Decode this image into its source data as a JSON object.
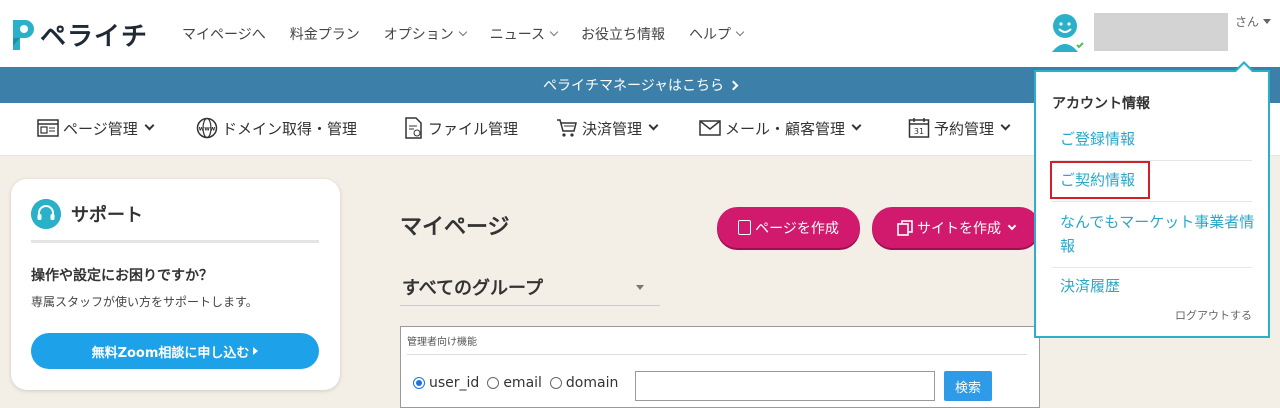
{
  "header": {
    "logo_text": "ペライチ",
    "nav": [
      {
        "label": "マイページへ",
        "has_chevron": false
      },
      {
        "label": "料金プラン",
        "has_chevron": false
      },
      {
        "label": "オプション",
        "has_chevron": true
      },
      {
        "label": "ニュース",
        "has_chevron": true
      },
      {
        "label": "お役立ち情報",
        "has_chevron": false
      },
      {
        "label": "ヘルプ",
        "has_chevron": true
      }
    ],
    "user_suffix": "さん"
  },
  "banner": {
    "text": "ペライチマネージャはこちら"
  },
  "subnav": [
    {
      "label": "ページ管理",
      "icon": "page-icon"
    },
    {
      "label": "ドメイン取得・管理",
      "icon": "www-icon"
    },
    {
      "label": "ファイル管理",
      "icon": "file-icon"
    },
    {
      "label": "決済管理",
      "icon": "cart-icon"
    },
    {
      "label": "メール・顧客管理",
      "icon": "mail-icon"
    },
    {
      "label": "予約管理",
      "icon": "calendar-icon",
      "calendar_day": "31"
    }
  ],
  "support": {
    "title": "サポート",
    "question": "操作や設定にお困りですか？",
    "description": "専属スタッフが使い方をサポートします。",
    "button": "無料Zoom相談に申し込む"
  },
  "main": {
    "title": "マイページ",
    "create_page": "ページを作成",
    "create_site": "サイトを作成",
    "group_select": "すべてのグループ",
    "admin": {
      "title": "管理者向け機能",
      "radios": [
        {
          "label": "user_id",
          "checked": true
        },
        {
          "label": "email",
          "checked": false
        },
        {
          "label": "domain",
          "checked": false
        }
      ],
      "search_value": "",
      "search_button": "検索"
    }
  },
  "account_menu": {
    "heading": "アカウント情報",
    "items": [
      {
        "label": "ご登録情報",
        "highlighted": false
      },
      {
        "label": "ご契約情報",
        "highlighted": true
      },
      {
        "label": "なんでもマーケット事業者情報",
        "highlighted": false
      },
      {
        "label": "決済履歴",
        "highlighted": false
      }
    ],
    "logout": "ログアウトする"
  },
  "colors": {
    "brand_pink": "#d11a6d",
    "banner_blue": "#3c7fa8",
    "accent_teal": "#2bb0c9",
    "zoom_blue": "#1da1e8",
    "highlight_red": "#d21f2a"
  }
}
